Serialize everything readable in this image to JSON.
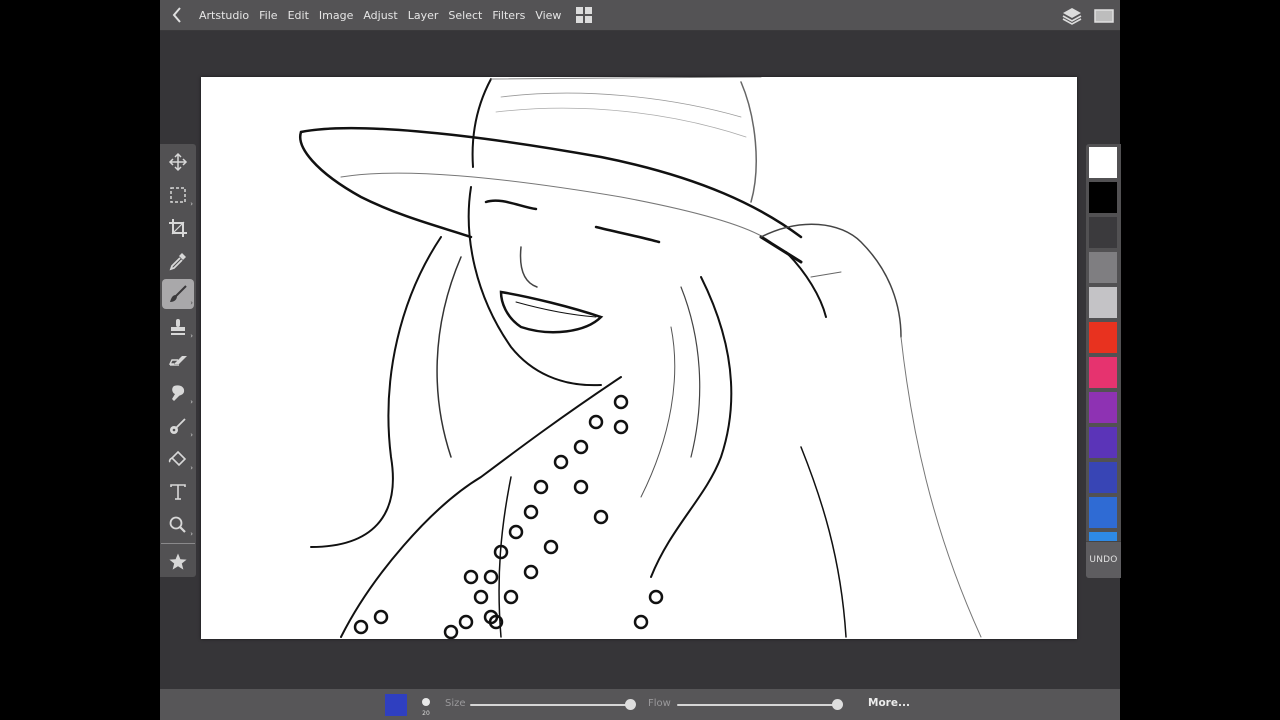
{
  "app": {
    "name": "Artstudio",
    "canvas_description": "Pencil-sketch style drawing of a smiling woman wearing a wide-brim hat and a polka-dot top"
  },
  "topbar": {
    "back_icon": "chevron-left-icon",
    "menu": [
      {
        "id": "file",
        "label": "File"
      },
      {
        "id": "edit",
        "label": "Edit"
      },
      {
        "id": "image",
        "label": "Image"
      },
      {
        "id": "adjust",
        "label": "Adjust"
      },
      {
        "id": "layer",
        "label": "Layer"
      },
      {
        "id": "select",
        "label": "Select"
      },
      {
        "id": "filters",
        "label": "Filters"
      },
      {
        "id": "view",
        "label": "View"
      }
    ],
    "grid_icon": "grid-icon",
    "right_icons": [
      "layers-icon",
      "fullscreen-icon"
    ]
  },
  "toolbar": {
    "tools": [
      {
        "id": "move",
        "icon": "move-icon",
        "has_submenu": false,
        "active": false
      },
      {
        "id": "marquee",
        "icon": "marquee-select-icon",
        "has_submenu": true,
        "active": false
      },
      {
        "id": "crop",
        "icon": "crop-icon",
        "has_submenu": false,
        "active": false
      },
      {
        "id": "eyedropper",
        "icon": "eyedropper-icon",
        "has_submenu": false,
        "active": false
      },
      {
        "id": "brush",
        "icon": "brush-icon",
        "has_submenu": true,
        "active": true
      },
      {
        "id": "stamp",
        "icon": "clone-stamp-icon",
        "has_submenu": true,
        "active": false
      },
      {
        "id": "eraser",
        "icon": "eraser-icon",
        "has_submenu": false,
        "active": false
      },
      {
        "id": "smudge",
        "icon": "smudge-icon",
        "has_submenu": true,
        "active": false
      },
      {
        "id": "dodge",
        "icon": "dodge-burn-icon",
        "has_submenu": true,
        "active": false
      },
      {
        "id": "fill",
        "icon": "paint-bucket-icon",
        "has_submenu": true,
        "active": false
      },
      {
        "id": "text",
        "icon": "text-icon",
        "has_submenu": false,
        "active": false
      },
      {
        "id": "zoom",
        "icon": "zoom-icon",
        "has_submenu": true,
        "active": false
      }
    ],
    "favorites_icon": "star-icon",
    "submenu_indicator": "›"
  },
  "palette": {
    "colors": [
      "#ffffff",
      "#000000",
      "#3b3a3d",
      "#7f7e81",
      "#c4c3c6",
      "#e8321f",
      "#e6336f",
      "#8e32b3",
      "#5b34b8",
      "#3845b5",
      "#2f6bd4",
      "#2e8ae6"
    ],
    "undo_label": "UNDO"
  },
  "bottombar": {
    "current_color": "#2f3fc0",
    "brush_size_value": "20",
    "size_label": "Size",
    "size_value_fraction": 1.0,
    "flow_label": "Flow",
    "flow_value_fraction": 1.0,
    "more_label": "More..."
  }
}
